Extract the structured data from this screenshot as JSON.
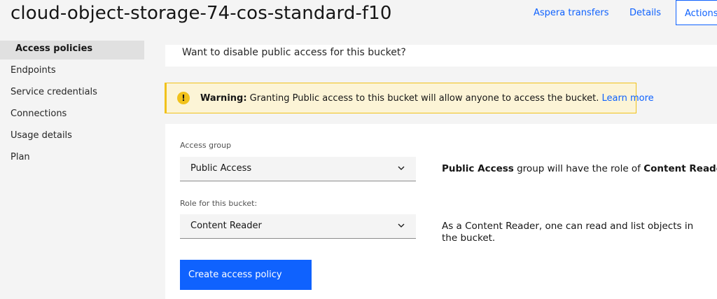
{
  "header": {
    "title": "cloud-object-storage-74-cos-standard-f10",
    "links": {
      "aspera": "Aspera transfers",
      "details": "Details"
    },
    "actions_label": "Actions..."
  },
  "sidebar": {
    "items": [
      {
        "label": "Access policies"
      },
      {
        "label": "Endpoints"
      },
      {
        "label": "Service credentials"
      },
      {
        "label": "Connections"
      },
      {
        "label": "Usage details"
      },
      {
        "label": "Plan"
      }
    ]
  },
  "main": {
    "disable_question": "Want to disable public access for this bucket?",
    "warning": {
      "prefix": "Warning:",
      "text": "Granting Public access to this bucket will allow anyone to access the bucket.",
      "link": "Learn more"
    },
    "access_group": {
      "label": "Access group",
      "value": "Public Access",
      "desc_bold_1": "Public Access",
      "desc_mid": "group will have the role of",
      "desc_bold_2": "Content Reader",
      "desc_end": "."
    },
    "role": {
      "label": "Role for this bucket:",
      "value": "Content Reader",
      "desc": "As a Content Reader, one can read and list objects in the bucket."
    },
    "create_button": "Create access policy"
  }
}
